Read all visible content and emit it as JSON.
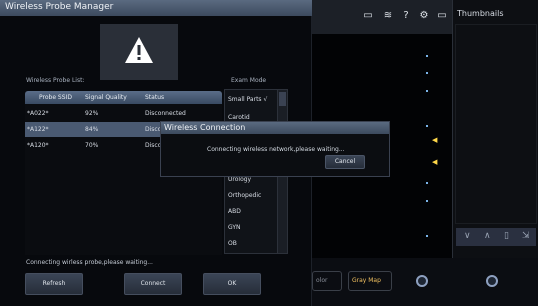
{
  "window": {
    "title": "Wireless Probe Manager"
  },
  "probe_list": {
    "label": "Wireless Probe List:",
    "columns": [
      "Probe SSID",
      "Signal Quality",
      "Status"
    ],
    "rows": [
      {
        "ssid": "*A022*",
        "signal": "92%",
        "status": "Disconnected",
        "selected": false
      },
      {
        "ssid": "*A122*",
        "signal": "84%",
        "status": "Disco",
        "selected": true
      },
      {
        "ssid": "*A120*",
        "signal": "70%",
        "status": "Disco",
        "selected": false
      }
    ]
  },
  "exam_mode": {
    "label": "Exam Mode",
    "items": [
      "Small Parts √",
      "Carotid",
      "",
      "",
      "",
      "Urology",
      "Orthopedic",
      "ABD",
      "GYN",
      "OB"
    ]
  },
  "status_text": "Connecting wirless probe,please waiting...",
  "buttons": {
    "refresh": "Refresh",
    "connect": "Connect",
    "ok": "OK"
  },
  "dialog": {
    "title": "Wireless Connection",
    "message": "Connecting wireless network,please waiting...",
    "cancel": "Cancel"
  },
  "background": {
    "thumbnails_title": "Thumbnails",
    "gray_map": "Gray Map",
    "left_chip": "olor"
  },
  "colors": {
    "title_bar": "#4a5a72",
    "selection": "#4a5a72",
    "marker": "#ffd84a"
  }
}
